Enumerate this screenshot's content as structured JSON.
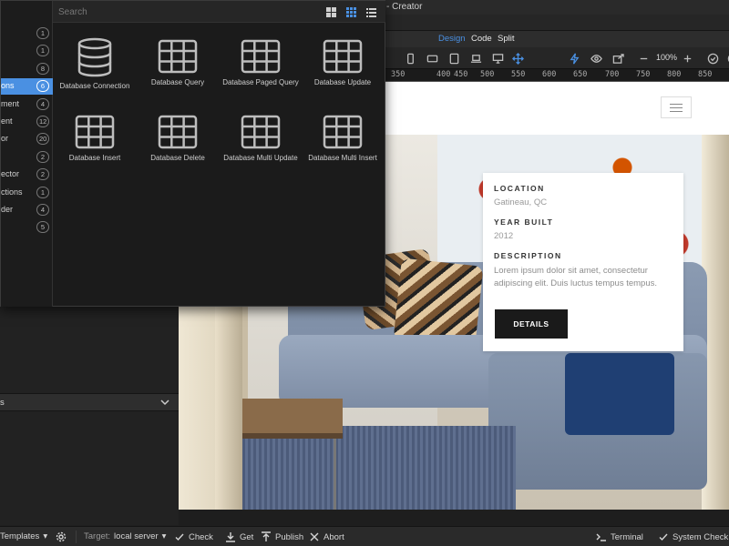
{
  "app": {
    "title_fragment": "- Creator"
  },
  "modes": {
    "design": "Design",
    "code": "Code",
    "split": "Split",
    "active_color": "#4a90e2"
  },
  "toolbar": {
    "zoom": "100%"
  },
  "ruler": {
    "ticks": [
      "350",
      "400",
      "450",
      "500",
      "550",
      "600",
      "650",
      "700",
      "750",
      "800",
      "850"
    ]
  },
  "components_panel": {
    "search_placeholder": "Search",
    "categories": [
      {
        "label": "",
        "count": "1"
      },
      {
        "label": "",
        "count": "1"
      },
      {
        "label": "",
        "count": "8"
      },
      {
        "label": "ons",
        "count": "6",
        "active": true
      },
      {
        "label": "ment",
        "count": "4"
      },
      {
        "label": "ent",
        "count": "12"
      },
      {
        "label": "or",
        "count": "20"
      },
      {
        "label": "",
        "count": "2"
      },
      {
        "label": "ector",
        "count": "2"
      },
      {
        "label": "ctions",
        "count": "1"
      },
      {
        "label": "der",
        "count": "4"
      },
      {
        "label": "",
        "count": "5"
      }
    ],
    "items": [
      {
        "label": "Database Connection",
        "icon": "database-icon"
      },
      {
        "label": "Database Query",
        "icon": "table-grid-icon"
      },
      {
        "label": "Database Paged Query",
        "icon": "table-grid-icon"
      },
      {
        "label": "Database Update",
        "icon": "table-grid-icon"
      },
      {
        "label": "Database Insert",
        "icon": "table-grid-icon"
      },
      {
        "label": "Database Delete",
        "icon": "table-grid-icon"
      },
      {
        "label": "Database Multi Update",
        "icon": "table-grid-icon"
      },
      {
        "label": "Database Multi Insert",
        "icon": "table-grid-icon"
      }
    ]
  },
  "left_section": {
    "title": "s"
  },
  "canvas": {
    "location_label": "LOCATION",
    "location_value": "Gatineau, QC",
    "year_label": "YEAR BUILT",
    "year_value": "2012",
    "desc_label": "DESCRIPTION",
    "desc_text": "Lorem ipsum dolor sit amet, consectetur adipiscing elit. Duis luctus tempus tempus.",
    "button": "DETAILS"
  },
  "statusbar": {
    "templates": "Templates",
    "target_label": "Target:",
    "target_value": "local server",
    "check": "Check",
    "get": "Get",
    "publish": "Publish",
    "abort": "Abort",
    "terminal": "Terminal",
    "system_check": "System Check"
  }
}
